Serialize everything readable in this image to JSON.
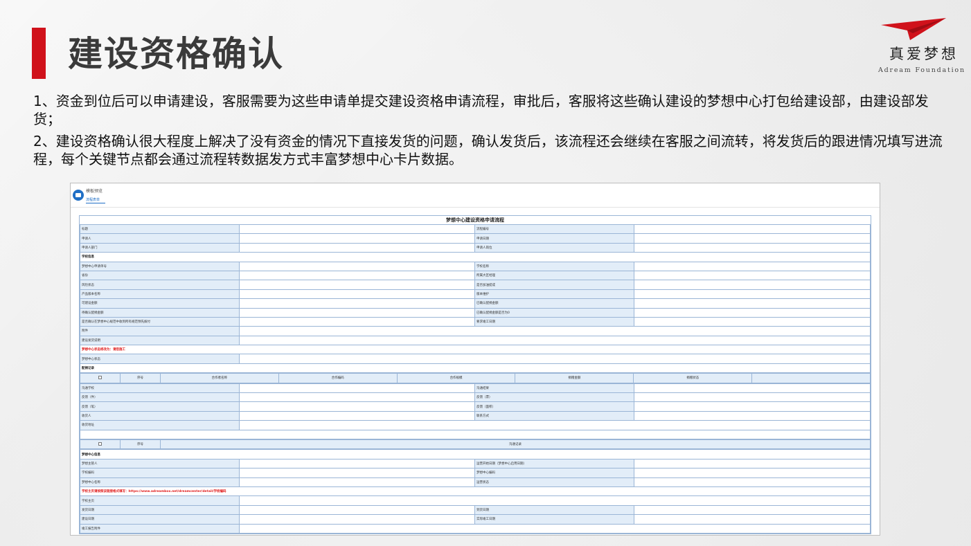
{
  "slide": {
    "title": "建设资格确认",
    "paragraph1": "1、资金到位后可以申请建设，客服需要为这些申请单提交建设资格申请流程，审批后，客服将这些确认建设的梦想中心打包给建设部，由建设部发货；",
    "paragraph2": "2、建设资格确认很大程度上解决了没有资金的情况下直接发货的问题，确认发货后，该流程还会继续在客服之间流转，将发货后的跟进情况填写进流程，每个关键节点都会通过流程转数据发方式丰富梦想中心卡片数据。",
    "accent_color": "#d0121b"
  },
  "logo": {
    "cn": "真爱梦想",
    "en": "Adream Foundation",
    "icon": "paper-plane-icon"
  },
  "screenshot": {
    "breadcrumb": "模板预览",
    "subtab": "流程表单",
    "form_title": "梦想中心建设资格申请流程",
    "rows_a": [
      [
        "标题",
        "流程编号"
      ],
      [
        "申请人",
        "申请日期"
      ],
      [
        "申请人部门",
        "申请人岗位"
      ]
    ],
    "section_school": "学校信息",
    "rows_b": [
      [
        "梦想中心申请单号",
        "学校名称"
      ],
      [
        "省份",
        "所属大区经理"
      ],
      [
        "风险状态",
        "是否加油提成"
      ],
      [
        "产品版本名称",
        "版本维护"
      ],
      [
        "可建设金额",
        "已确认配捐金额"
      ],
      [
        "待确认配捐金额",
        "已确认配捐金额是否为0"
      ],
      [
        "是否确认在梦想中心规范中收到所有规范预先拨付",
        "要求竣工日期"
      ]
    ],
    "row_attach": "附件",
    "row_note": "建设发货说明",
    "red_status": "梦想中心状态修改为：请您施工",
    "row_dc_status": "梦想中心状态",
    "section_record": "配捐记录",
    "record_headers": [
      "序号",
      "合作者名称",
      "合作编码",
      "合作规模",
      "捐赠金额",
      "捐赠状态"
    ],
    "rows_c": [
      [
        "沟通学校",
        "沟通结果"
      ],
      [
        "反馈（件）",
        "反馈（票）"
      ],
      [
        "反馈（笔）",
        "反馈（面积）"
      ],
      [
        "收货人",
        "联系方式"
      ]
    ],
    "row_addr": "收货地址",
    "comm_headers": [
      "序号",
      "沟通记录"
    ],
    "section_center": "梦想中心信息",
    "rows_d": [
      [
        "梦想主管人",
        "运营开始日期（梦想中心启用日期）"
      ],
      [
        "学校编码",
        "梦想中心编码"
      ],
      [
        "梦想中心名称",
        "运营状态"
      ]
    ],
    "red_url": "学校主页请按照该链接格式填写：https://www.adreambox.net/dreamcenter/detail/学校编码",
    "row_home": "学校主页",
    "rows_e": [
      [
        "发货日期",
        "到货日期"
      ],
      [
        "建设日期",
        "实际竣工日期"
      ]
    ],
    "row_attach2": "竣工报告附件"
  }
}
